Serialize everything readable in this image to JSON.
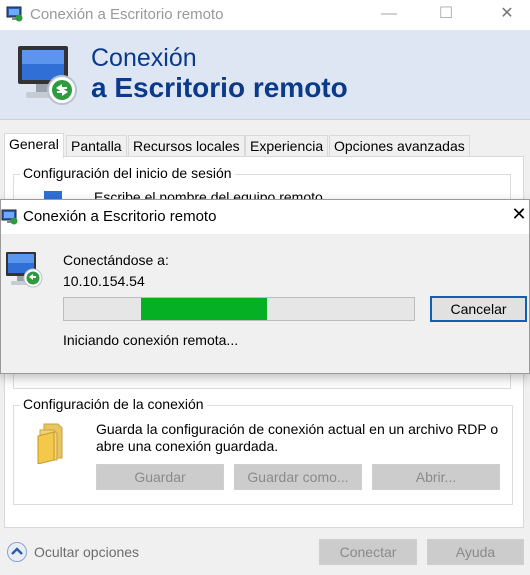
{
  "main_window": {
    "title": "Conexión a Escritorio remoto",
    "window_buttons": {
      "minimize": "—",
      "maximize": "☐",
      "close": "✕"
    },
    "banner": {
      "line1": "Conexión",
      "line2": "a Escritorio remoto"
    },
    "tabs": [
      {
        "label": "General",
        "active": true
      },
      {
        "label": "Pantalla",
        "active": false
      },
      {
        "label": "Recursos locales",
        "active": false
      },
      {
        "label": "Experiencia",
        "active": false
      },
      {
        "label": "Opciones avanzadas",
        "active": false
      }
    ],
    "login_group": {
      "label": "Configuración del inicio de sesión",
      "partial_text": "Escribe el nombre del equipo remoto"
    },
    "connection_group": {
      "label": "Configuración de la conexión",
      "description_line1": "Guarda la configuración de conexión actual en un archivo RDP o",
      "description_line2": "abre una conexión guardada.",
      "buttons": {
        "save": "Guardar",
        "save_as": "Guardar como...",
        "open": "Abrir..."
      }
    },
    "bottom": {
      "hide_options": "Ocultar opciones",
      "connect": "Conectar",
      "help": "Ayuda"
    }
  },
  "dialog": {
    "title": "Conexión a Escritorio remoto",
    "close": "✕",
    "connecting_label": "Conectándose a:",
    "address": "10.10.154.54",
    "cancel": "Cancelar",
    "status": "Iniciando conexión remota...",
    "progress": {
      "start": 0.22,
      "end": 0.58,
      "color": "#06b025"
    }
  },
  "colors": {
    "banner_bg": "#dde6f2",
    "banner_text": "#0b3a8a",
    "focus_border": "#0f5eb8"
  }
}
